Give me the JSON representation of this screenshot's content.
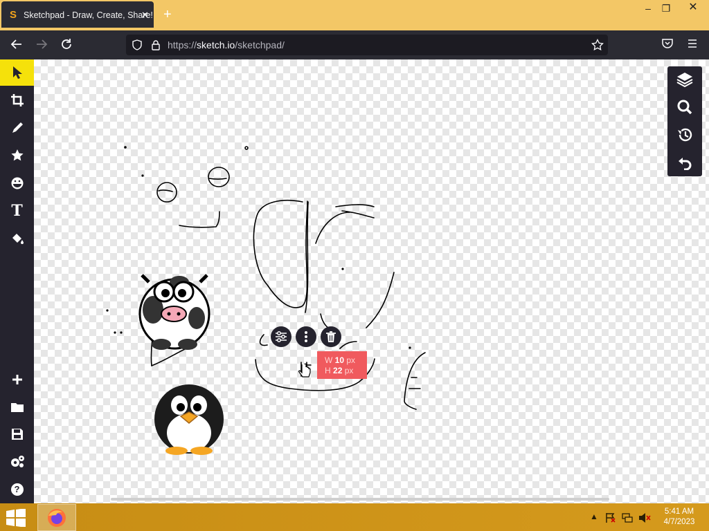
{
  "browser": {
    "tab_title": "Sketchpad - Draw, Create, Share!",
    "tab_close": "✕",
    "new_tab": "+",
    "url_prefix": "https://",
    "url_host": "sketch.io",
    "url_path": "/sketchpad/",
    "favicon_letter": "S"
  },
  "window": {
    "minimize": "–",
    "restore": "❐",
    "close": "✕"
  },
  "sketchpad": {
    "left_tools": [
      "select-arrow",
      "crop",
      "pencil",
      "star",
      "sticker",
      "text",
      "fill-bucket"
    ],
    "text_tool_label": "T",
    "bottom_tools": [
      "add",
      "folder",
      "save",
      "settings",
      "help"
    ],
    "help_label": "?",
    "right_tools": [
      "layers",
      "zoom",
      "history",
      "undo"
    ],
    "selection_tooltip": {
      "w_label": "W",
      "w_value": "10",
      "h_label": "H",
      "h_value": "22",
      "unit": "px"
    },
    "active_tool_color": "#f5e10b",
    "tooltip_color": "#f05a5e"
  },
  "taskbar": {
    "time": "5:41 AM",
    "date": "4/7/2023"
  }
}
